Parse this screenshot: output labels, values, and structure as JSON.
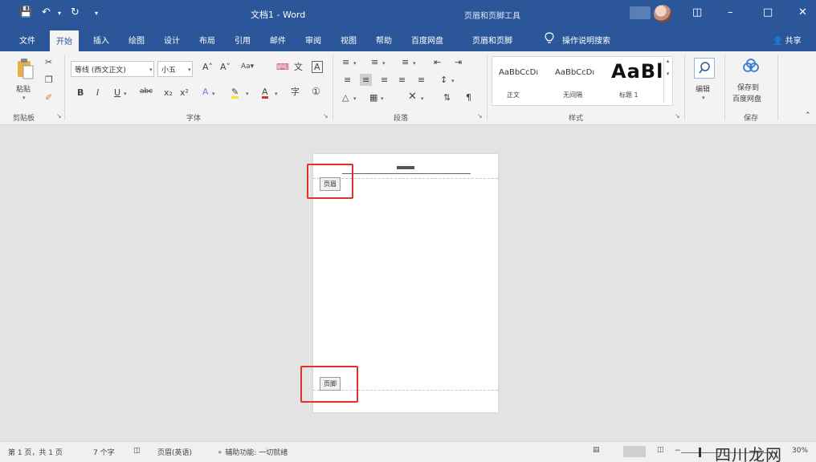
{
  "title_bar": {
    "title": "文档1 - Word",
    "context_title": "页眉和页脚工具"
  },
  "tabs": [
    {
      "label": "文件"
    },
    {
      "label": "开始"
    },
    {
      "label": "插入"
    },
    {
      "label": "绘图"
    },
    {
      "label": "设计"
    },
    {
      "label": "布局"
    },
    {
      "label": "引用"
    },
    {
      "label": "邮件"
    },
    {
      "label": "审阅"
    },
    {
      "label": "视图"
    },
    {
      "label": "帮助"
    },
    {
      "label": "百度网盘"
    },
    {
      "label": "页眉和页脚"
    }
  ],
  "tell_me": "操作说明搜索",
  "share": "共享",
  "ribbon": {
    "clipboard": {
      "paste": "粘贴",
      "group": "剪贴板"
    },
    "font": {
      "name": "等线 (西文正文)",
      "size": "小五",
      "group": "字体"
    },
    "paragraph": {
      "group": "段落"
    },
    "styles": {
      "group": "样式",
      "items": [
        {
          "sample": "AaBbCcDı",
          "name": "正文"
        },
        {
          "sample": "AaBbCcDı",
          "name": "无间隔"
        },
        {
          "sample": "AaBl",
          "name": "标题 1"
        }
      ]
    },
    "editing": {
      "label": "编辑"
    },
    "save": {
      "label_line1": "保存到",
      "label_line2": "百度网盘",
      "group": "保存"
    }
  },
  "document": {
    "header_tag": "页眉",
    "footer_tag": "页脚"
  },
  "status": {
    "page": "第 1 页，共 1 页",
    "words": "7 个字",
    "mode": "页眉(英语)",
    "accessibility": "辅助功能: 一切就绪",
    "zoom": "30%"
  },
  "watermark": "四川龙网"
}
